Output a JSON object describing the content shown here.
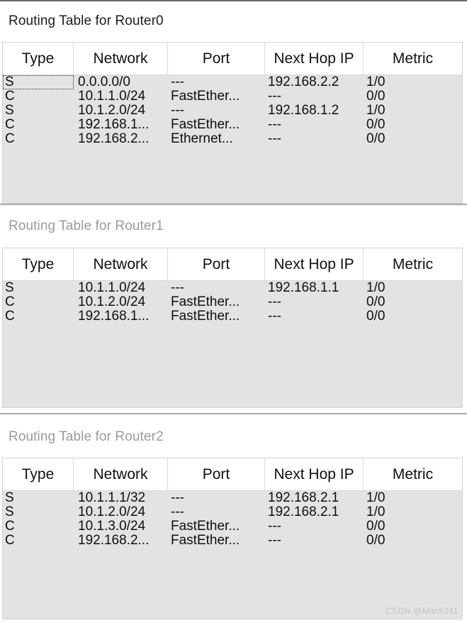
{
  "meta": {
    "watermark": "CSDN @Mitch311",
    "accent_color": "#e3e3e3",
    "title_active_color": "#1d1d1d",
    "title_inactive_color": "#9b9b9b"
  },
  "columns": [
    "Type",
    "Network",
    "Port",
    "Next Hop IP",
    "Metric"
  ],
  "panels": [
    {
      "title": "Routing Table for Router0",
      "active": true,
      "rows": [
        {
          "type": "S",
          "network": "0.0.0.0/0",
          "port": "---",
          "next_hop": "192.168.2.2",
          "metric": "1/0",
          "focused": true
        },
        {
          "type": "C",
          "network": "10.1.1.0/24",
          "port": "FastEther...",
          "next_hop": "---",
          "metric": "0/0",
          "focused": false
        },
        {
          "type": "S",
          "network": "10.1.2.0/24",
          "port": "---",
          "next_hop": "192.168.1.2",
          "metric": "1/0",
          "focused": false
        },
        {
          "type": "C",
          "network": "192.168.1...",
          "port": "FastEther...",
          "next_hop": "---",
          "metric": "0/0",
          "focused": false
        },
        {
          "type": "C",
          "network": "192.168.2...",
          "port": "Ethernet...",
          "next_hop": "---",
          "metric": "0/0",
          "focused": false
        }
      ]
    },
    {
      "title": "Routing Table for Router1",
      "active": false,
      "rows": [
        {
          "type": "S",
          "network": "10.1.1.0/24",
          "port": "---",
          "next_hop": "192.168.1.1",
          "metric": "1/0",
          "focused": false
        },
        {
          "type": "C",
          "network": "10.1.2.0/24",
          "port": "FastEther...",
          "next_hop": "---",
          "metric": "0/0",
          "focused": false
        },
        {
          "type": "C",
          "network": "192.168.1...",
          "port": "FastEther...",
          "next_hop": "---",
          "metric": "0/0",
          "focused": false
        }
      ]
    },
    {
      "title": "Routing Table for Router2",
      "active": false,
      "rows": [
        {
          "type": "S",
          "network": "10.1.1.1/32",
          "port": "---",
          "next_hop": "192.168.2.1",
          "metric": "1/0",
          "focused": false
        },
        {
          "type": "S",
          "network": "10.1.2.0/24",
          "port": "---",
          "next_hop": "192.168.2.1",
          "metric": "1/0",
          "focused": false
        },
        {
          "type": "C",
          "network": "10.1.3.0/24",
          "port": "FastEther...",
          "next_hop": "---",
          "metric": "0/0",
          "focused": false
        },
        {
          "type": "C",
          "network": "192.168.2...",
          "port": "FastEther...",
          "next_hop": "---",
          "metric": "0/0",
          "focused": false
        }
      ]
    }
  ]
}
